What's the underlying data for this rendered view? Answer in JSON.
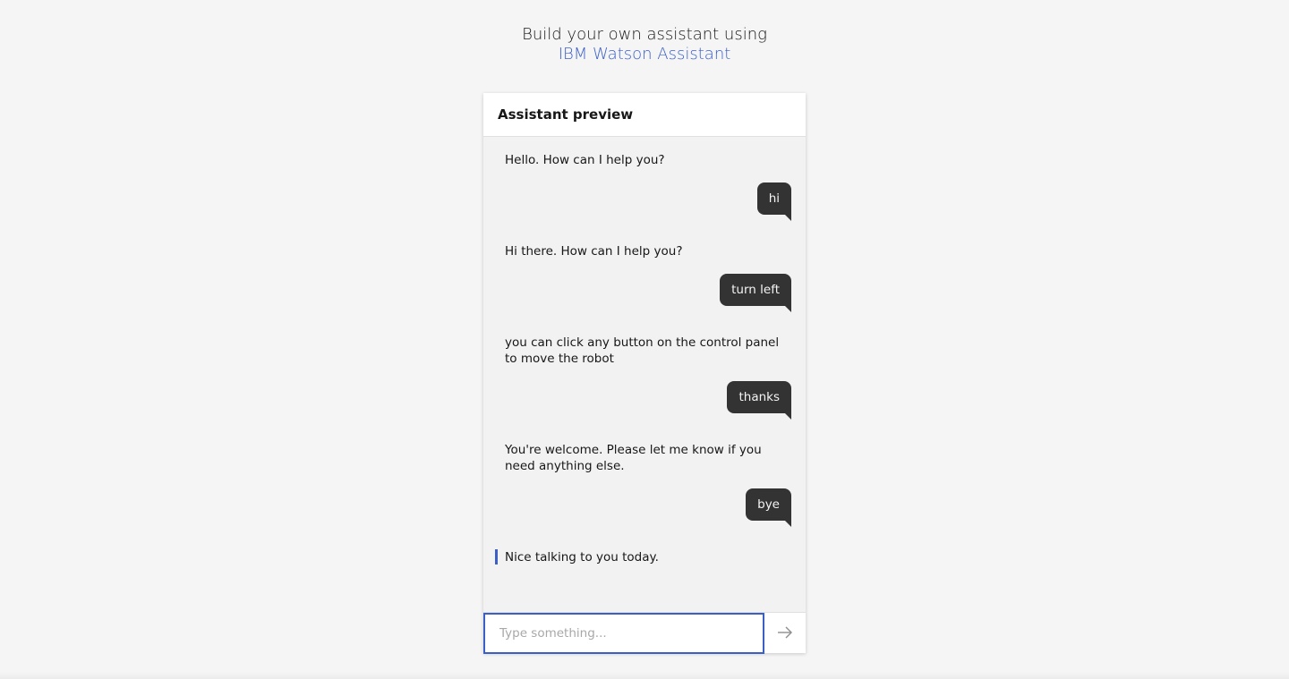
{
  "intro": {
    "line1": "Build your own assistant using",
    "link_text": "IBM Watson Assistant"
  },
  "panel": {
    "title": "Assistant preview"
  },
  "messages": [
    {
      "sender": "bot",
      "text": "Hello. How can I help you?"
    },
    {
      "sender": "user",
      "text": "hi"
    },
    {
      "sender": "bot",
      "text": "Hi there. How can I help you?"
    },
    {
      "sender": "user",
      "text": "turn left"
    },
    {
      "sender": "bot",
      "text": "you can click any button on the control panel to move the robot"
    },
    {
      "sender": "user",
      "text": "thanks"
    },
    {
      "sender": "bot",
      "text": "You're welcome. Please let me know if you need anything else."
    },
    {
      "sender": "user",
      "text": "bye"
    },
    {
      "sender": "bot",
      "text": "Nice talking to you today."
    }
  ],
  "input": {
    "placeholder": "Type something...",
    "value": ""
  },
  "icons": {
    "send": "arrow-right-icon"
  },
  "colors": {
    "accent": "#3b5fc7",
    "user_bubble": "#333333",
    "background": "#f5f5f5",
    "panel_background": "#f2f2f2"
  }
}
